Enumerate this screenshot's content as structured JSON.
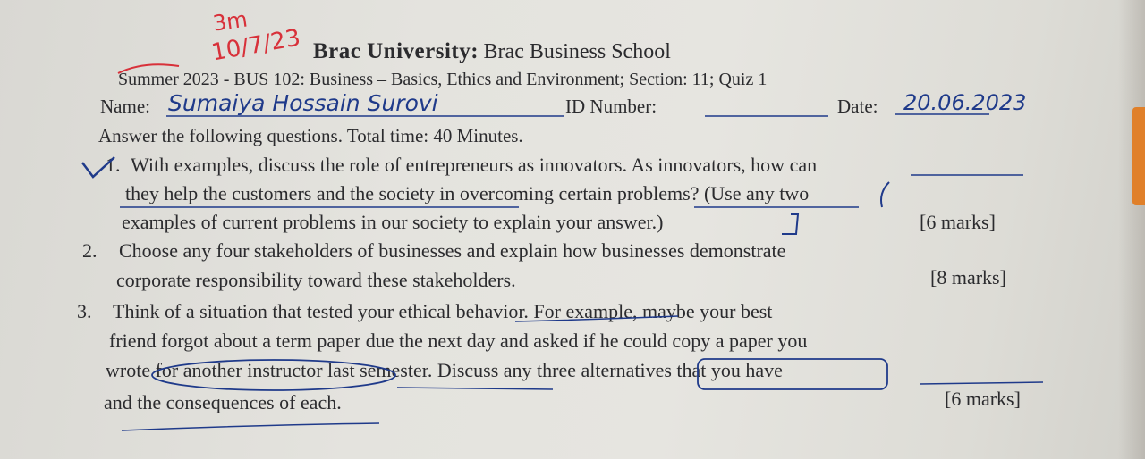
{
  "header": {
    "red_note_line1": "3m",
    "red_note_line2": "10/7/23",
    "university": "Brac University:",
    "school": "Brac Business School",
    "course_line": "Summer 2023 - BUS 102: Business – Basics, Ethics and Environment; Section: 11; Quiz 1"
  },
  "student": {
    "name_label": "Name:",
    "name_value": "Sumaiya Hossain Surovi",
    "id_label": "ID Number:",
    "date_label": "Date:",
    "date_value": "20.06.2023"
  },
  "instructions": "Answer the following questions. Total time: 40 Minutes.",
  "questions": [
    {
      "number": "1.",
      "line1": "With examples, discuss the role of entrepreneurs as innovators. As innovators, how can",
      "line2": "they help the customers and the society in overcoming certain problems? (Use any two",
      "line3": "examples of current problems in our society to explain your answer.)",
      "marks": "[6 marks]"
    },
    {
      "number": "2.",
      "line1": "Choose any four stakeholders of businesses and explain how businesses demonstrate",
      "line2": "corporate responsibility toward these stakeholders.",
      "marks": "[8 marks]"
    },
    {
      "number": "3.",
      "line1": "Think of a situation that tested your ethical behavior. For example, maybe your best",
      "line2": "friend forgot about a term paper due the next day and asked if he could copy a paper you",
      "line3": "wrote for another instructor last semester. Discuss any three alternatives that you have",
      "line4": "and the consequences of each.",
      "marks": "[6 marks]"
    }
  ],
  "colors": {
    "ink_blue": "#1f3a8a",
    "ink_red": "#d8313a",
    "print": "#2b2b2e"
  }
}
